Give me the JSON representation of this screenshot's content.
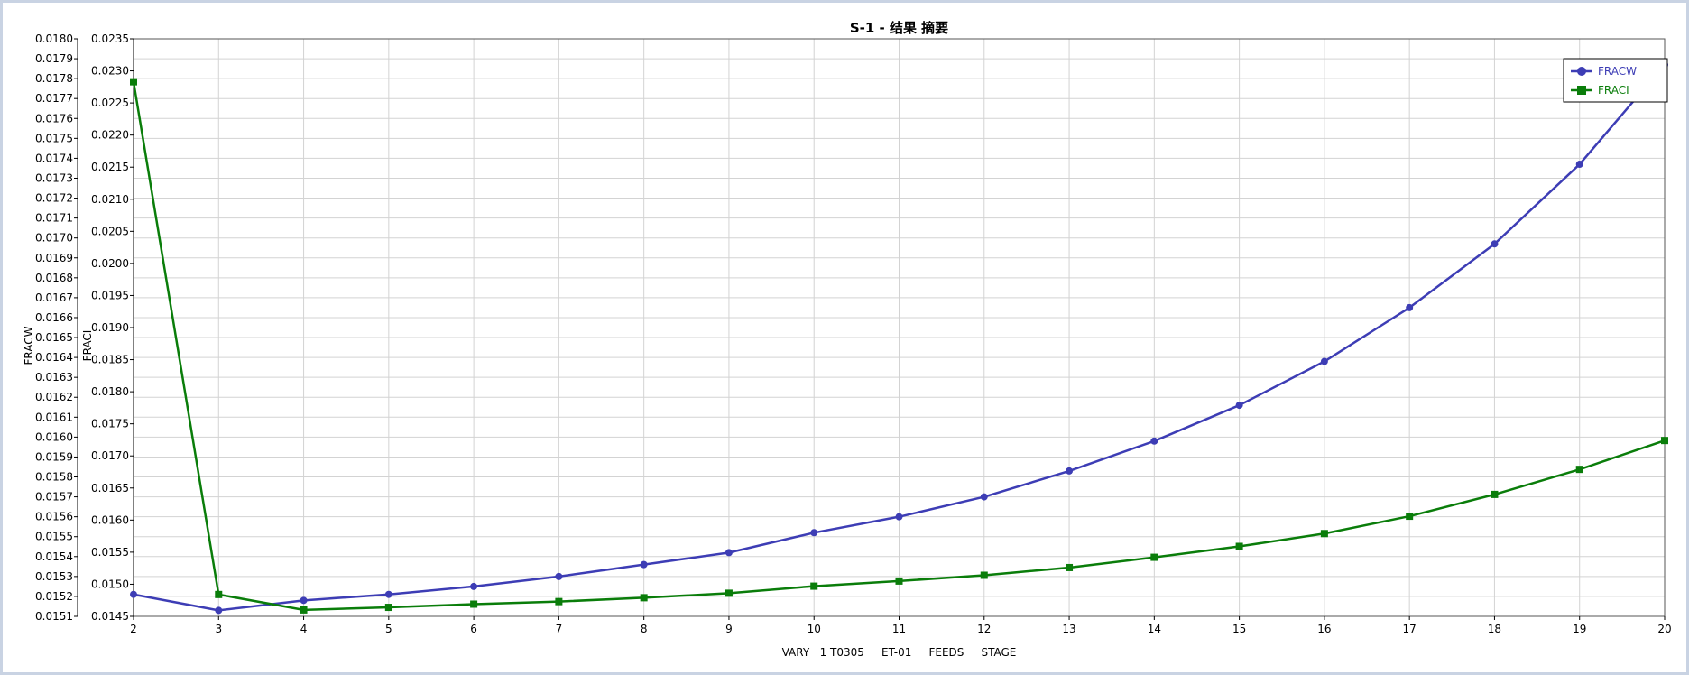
{
  "chart_data": {
    "type": "line",
    "title": "S-1 - 结果 摘要",
    "xlabel": "VARY   1 T0305     ET-01     FEEDS     STAGE",
    "x": [
      2,
      3,
      4,
      5,
      6,
      7,
      8,
      9,
      10,
      11,
      12,
      13,
      14,
      15,
      16,
      17,
      18,
      19,
      20
    ],
    "xlim": [
      2,
      20
    ],
    "x_ticks": [
      "2",
      "3",
      "4",
      "5",
      "6",
      "7",
      "8",
      "9",
      "10",
      "11",
      "12",
      "13",
      "14",
      "15",
      "16",
      "17",
      "18",
      "19",
      "20"
    ],
    "grid": true,
    "legend_position": "top-right",
    "y_axes": [
      {
        "id": "left-outer",
        "label": "FRACW",
        "ylim": [
          0.0151,
          0.018
        ],
        "ticks": [
          "0.0151",
          "0.0152",
          "0.0153",
          "0.0154",
          "0.0155",
          "0.0156",
          "0.0157",
          "0.0158",
          "0.0159",
          "0.0160",
          "0.0161",
          "0.0162",
          "0.0163",
          "0.0164",
          "0.0165",
          "0.0166",
          "0.0167",
          "0.0168",
          "0.0169",
          "0.0170",
          "0.0171",
          "0.0172",
          "0.0173",
          "0.0174",
          "0.0175",
          "0.0176",
          "0.0177",
          "0.0178",
          "0.0179",
          "0.0180"
        ]
      },
      {
        "id": "left-inner",
        "label": "FRACI",
        "ylim": [
          0.0145,
          0.0235
        ],
        "ticks": [
          "0.0145",
          "0.0150",
          "0.0155",
          "0.0160",
          "0.0165",
          "0.0170",
          "0.0175",
          "0.0180",
          "0.0185",
          "0.0190",
          "0.0195",
          "0.0200",
          "0.0205",
          "0.0210",
          "0.0215",
          "0.0220",
          "0.0225",
          "0.0230",
          "0.0235"
        ]
      }
    ],
    "series": [
      {
        "name": "FRACW",
        "axis": "left-outer",
        "color": "#3d3db5",
        "marker": "circle",
        "values": [
          0.01521,
          0.01513,
          0.01518,
          0.01521,
          0.01525,
          0.0153,
          0.01536,
          0.01542,
          0.01552,
          0.0156,
          0.0157,
          0.01583,
          0.01598,
          0.01616,
          0.01638,
          0.01665,
          0.01697,
          0.01737,
          0.01787
        ]
      },
      {
        "name": "FRACI",
        "axis": "left-inner",
        "color": "#0a7d0a",
        "marker": "square",
        "values": [
          0.02283,
          0.01484,
          0.0146,
          0.01464,
          0.01469,
          0.01473,
          0.01479,
          0.01486,
          0.01497,
          0.01505,
          0.01514,
          0.01526,
          0.01542,
          0.01559,
          0.01579,
          0.01606,
          0.0164,
          0.01679,
          0.01724
        ]
      }
    ]
  }
}
